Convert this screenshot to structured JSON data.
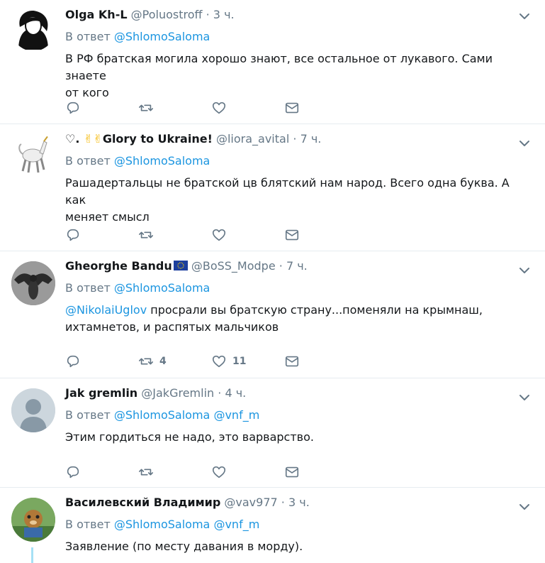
{
  "tweets": [
    {
      "name": "Olga Kh-L",
      "handle": "@Poluostroff",
      "time": "3 ч.",
      "reply_prefix": "В ответ",
      "reply_to_1": "@ShlomoSaloma",
      "text_line1": "В РФ братская могила хорошо знают, все остальное от лукавого. Сами знаете",
      "text_line2": "от кого",
      "retweets": "",
      "likes": ""
    },
    {
      "name_prefix": "♡.",
      "name_emoji": "✌✌",
      "name": "Glory to Ukraine!",
      "handle": "@liora_avital",
      "time": "7 ч.",
      "reply_prefix": "В ответ",
      "reply_to_1": "@ShlomoSaloma",
      "text_line1": "Рашадертальцы не братской цв блятский нам народ. Всего одна буква. А как",
      "text_line2": "меняет смысл",
      "retweets": "",
      "likes": ""
    },
    {
      "name": "Gheorghe Bandu",
      "handle": "@BoSS_Modpe",
      "time": "7 ч.",
      "reply_prefix": "В ответ",
      "reply_to_1": "@ShlomoSaloma",
      "mention": "@NikolaiUglov",
      "text_line1_rest": " просрали вы братскую страну...поменяли на крымнаш,",
      "text_line2": "ихтамнетов, и распятых мальчиков",
      "retweets": "4",
      "likes": "11"
    },
    {
      "name": "Jak gremlin",
      "handle": "@JakGremlin",
      "time": "4 ч.",
      "reply_prefix": "В ответ",
      "reply_to_1": "@ShlomoSaloma",
      "reply_to_2": "@vnf_m",
      "text_line1": "Этим гордиться не надо, это варварство.",
      "retweets": "",
      "likes": ""
    },
    {
      "name": "Василевский Владимир",
      "handle": "@vav977",
      "time": "3 ч.",
      "reply_prefix": "В ответ",
      "reply_to_1": "@ShlomoSaloma",
      "reply_to_2": "@vnf_m",
      "text_line1": "Заявление (по месту давания в морду)."
    }
  ],
  "sep": "·",
  "colors": {
    "link": "#1b95e0",
    "secondary": "#657786",
    "divider": "#e6ecf0"
  }
}
